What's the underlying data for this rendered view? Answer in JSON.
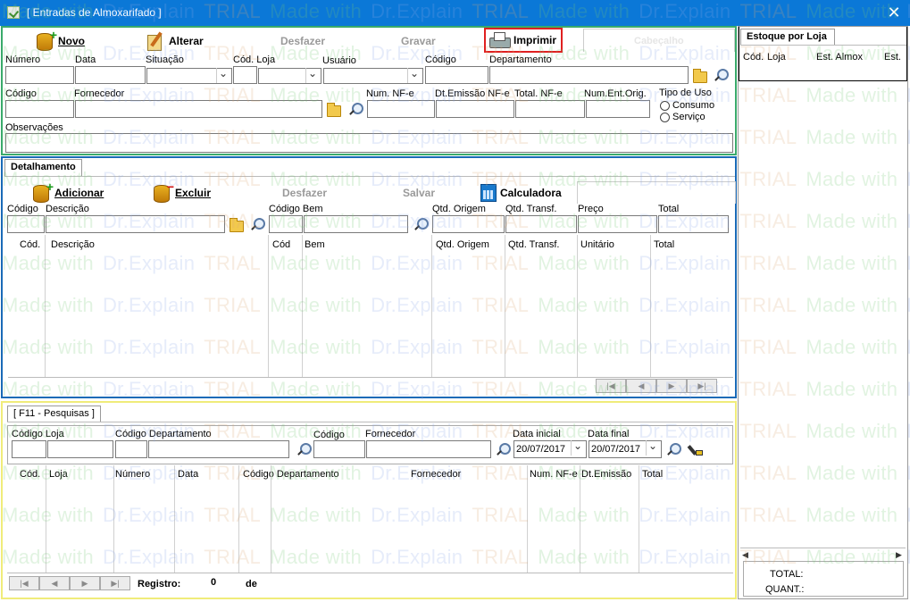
{
  "window": {
    "title": "[ Entradas de Almoxarifado ]",
    "close_glyph": "✕"
  },
  "toolbar": {
    "novo": "Novo",
    "alterar": "Alterar",
    "desfazer": "Desfazer",
    "gravar": "Gravar",
    "imprimir": "Imprimir",
    "cabecalho": "Cabeçalho"
  },
  "header_form": {
    "numero": "Número",
    "data": "Data",
    "situacao": "Situação",
    "cod_loja": "Cód.  Loja",
    "usuario": "Usuário",
    "codigo": "Código",
    "departamento": "Departamento",
    "codigo2": "Código",
    "fornecedor": "Fornecedor",
    "num_nfe": "Num. NF-e",
    "dt_emissao": "Dt.Emissão NF-e",
    "total_nfe": "Total. NF-e",
    "num_ent_orig": "Num.Ent.Orig.",
    "tipo_uso": "Tipo de Uso",
    "consumo": "Consumo",
    "servico": "Serviço",
    "observacoes": "Observações"
  },
  "detalhamento": {
    "tab": "Detalhamento",
    "adicionar": "Adicionar",
    "excluir": "Excluir",
    "desfazer": "Desfazer",
    "salvar": "Salvar",
    "calculadora": "Calculadora",
    "codigo": "Código",
    "descricao": "Descrição",
    "codigo_bem": "Código  Bem",
    "qtd_origem": "Qtd. Origem",
    "qtd_transf": "Qtd. Transf.",
    "preco": "Preço",
    "total": "Total",
    "grid": {
      "cod": "Cód.",
      "descricao": "Descrição",
      "cod2": "Cód",
      "bem": "Bem",
      "qtd_origem": "Qtd. Origem",
      "qtd_transf": "Qtd. Transf.",
      "unitario": "Unitário",
      "total": "Total"
    }
  },
  "pesquisas": {
    "tab": "[ F11 - Pesquisas ]",
    "codigo_loja": "Código   Loja",
    "codigo_depto": "Código  Departamento",
    "codigo": "Código",
    "fornecedor": "Fornecedor",
    "data_inicial": "Data inicial",
    "data_final": "Data final",
    "data_inicial_value": "20/07/2017",
    "data_final_value": "20/07/2017",
    "grid": {
      "cod": "Cód.",
      "loja": "Loja",
      "numero": "Número",
      "data": "Data",
      "codigo_depto": "Código  Departamento",
      "fornecedor": "Fornecedor",
      "num_nfe": "Num. NF-e",
      "dt_emissao": "Dt.Emissão",
      "total": "Total"
    },
    "registro_label": "Registro:",
    "registro_value": "0",
    "de": "de"
  },
  "estoque": {
    "tab": "Estoque por Loja",
    "cod": "Cód.",
    "loja": "Loja",
    "est_almox": "Est. Almox",
    "est": "Est.",
    "total": "TOTAL:",
    "quant": "QUANT.:"
  },
  "watermark": {
    "made_with": "Made with",
    "dr_explain": "Dr.Explain",
    "trial": "TRIAL"
  },
  "colors": {
    "title_bg": "#0b78d7",
    "green_border": "#3aaa6b",
    "blue_border": "#1a6ab7",
    "yellow_border": "#f0ec7a",
    "highlight": "#e02020"
  }
}
